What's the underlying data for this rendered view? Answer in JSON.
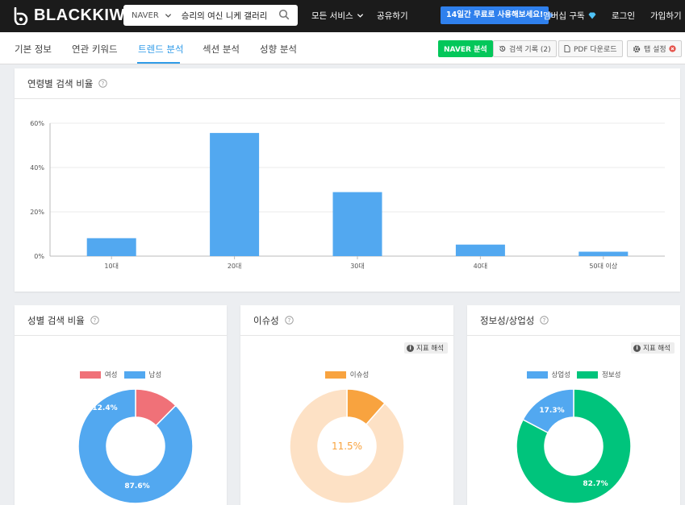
{
  "header": {
    "logo_text": "BLACKKIWI",
    "search_engine": "NAVER",
    "search_query": "승리의 여신 니케 갤러리",
    "nav_all_services": "모든 서비스",
    "nav_share": "공유하기",
    "promo": "14일간 무료로 사용해보세요!",
    "membership": "멤버십 구독",
    "login": "로그인",
    "signup": "가입하기"
  },
  "tabs": {
    "items": [
      "기본 정보",
      "연관 키워드",
      "트렌드 분석",
      "섹션 분석",
      "성향 분석"
    ],
    "active": "트렌드 분석"
  },
  "toolbar": {
    "naver_analysis": "NAVER 분석",
    "search_history": "검색 기록 (2)",
    "pdf_download": "PDF 다운로드",
    "tab_settings": "탭 설정"
  },
  "age_card": {
    "title": "연령별 검색 비율"
  },
  "gender_card": {
    "title": "성별 검색 비율",
    "female_label": "여성",
    "male_label": "남성",
    "female_pct": "12.4%",
    "male_pct": "87.6%"
  },
  "issue_card": {
    "title": "이슈성",
    "interp": "지표 해석",
    "legend": "이슈성",
    "center_pct": "11.5%"
  },
  "info_card": {
    "title": "정보성/상업성",
    "interp": "지표 해석",
    "commercial_label": "상업성",
    "informational_label": "정보성",
    "commercial_pct": "17.3%",
    "informational_pct": "82.7%"
  },
  "colors": {
    "blue": "#52a8f0",
    "red": "#f07178",
    "orange": "#f8a33f",
    "peach": "#fde1c5",
    "green": "#00c47c",
    "accent": "#2f9be8"
  },
  "chart_data": [
    {
      "type": "bar",
      "categories": [
        "10대",
        "20대",
        "30대",
        "40대",
        "50대 이상"
      ],
      "values": [
        8.1,
        55.6,
        28.9,
        5.2,
        2.0
      ],
      "ylim": [
        0,
        60
      ],
      "yticks": [
        "0%",
        "20%",
        "40%",
        "60%"
      ],
      "grid": true
    },
    {
      "type": "pie",
      "labels": [
        "여성",
        "남성"
      ],
      "values": [
        12.4,
        87.6
      ]
    },
    {
      "type": "pie",
      "labels": [
        "이슈성"
      ],
      "values": [
        11.5
      ]
    },
    {
      "type": "pie",
      "labels": [
        "상업성",
        "정보성"
      ],
      "values": [
        17.3,
        82.7
      ]
    }
  ]
}
